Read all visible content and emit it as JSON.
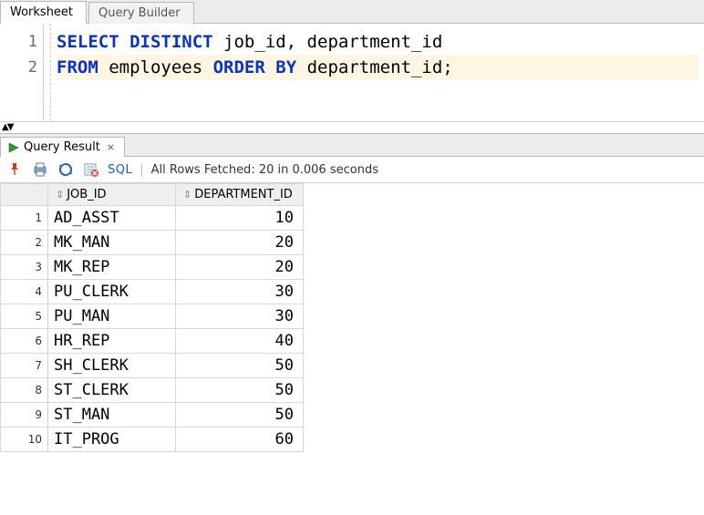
{
  "tabs": {
    "worksheet": "Worksheet",
    "query_builder": "Query Builder"
  },
  "editor": {
    "lines": [
      {
        "n": "1",
        "tokens": [
          {
            "t": "SELECT",
            "kw": true
          },
          {
            "t": " "
          },
          {
            "t": "DISTINCT",
            "kw": true
          },
          {
            "t": " job_id, department_id"
          }
        ]
      },
      {
        "n": "2",
        "hl": true,
        "tokens": [
          {
            "t": "FROM",
            "kw": true
          },
          {
            "t": " employees "
          },
          {
            "t": "ORDER",
            "kw": true
          },
          {
            "t": " "
          },
          {
            "t": "BY",
            "kw": true
          },
          {
            "t": " department_id;"
          }
        ]
      }
    ]
  },
  "result_tab": {
    "label": "Query Result",
    "close": "×"
  },
  "toolbar": {
    "sql_label": "SQL",
    "status": "All Rows Fetched: 20 in 0.006 seconds"
  },
  "grid": {
    "columns": [
      {
        "key": "job_id",
        "label": "JOB_ID",
        "align": "left"
      },
      {
        "key": "department_id",
        "label": "DEPARTMENT_ID",
        "align": "right"
      }
    ],
    "rows": [
      {
        "n": "1",
        "job_id": "AD_ASST",
        "department_id": "10"
      },
      {
        "n": "2",
        "job_id": "MK_MAN",
        "department_id": "20"
      },
      {
        "n": "3",
        "job_id": "MK_REP",
        "department_id": "20"
      },
      {
        "n": "4",
        "job_id": "PU_CLERK",
        "department_id": "30"
      },
      {
        "n": "5",
        "job_id": "PU_MAN",
        "department_id": "30"
      },
      {
        "n": "6",
        "job_id": "HR_REP",
        "department_id": "40"
      },
      {
        "n": "7",
        "job_id": "SH_CLERK",
        "department_id": "50"
      },
      {
        "n": "8",
        "job_id": "ST_CLERK",
        "department_id": "50"
      },
      {
        "n": "9",
        "job_id": "ST_MAN",
        "department_id": "50"
      },
      {
        "n": "10",
        "job_id": "IT_PROG",
        "department_id": "60"
      }
    ]
  }
}
